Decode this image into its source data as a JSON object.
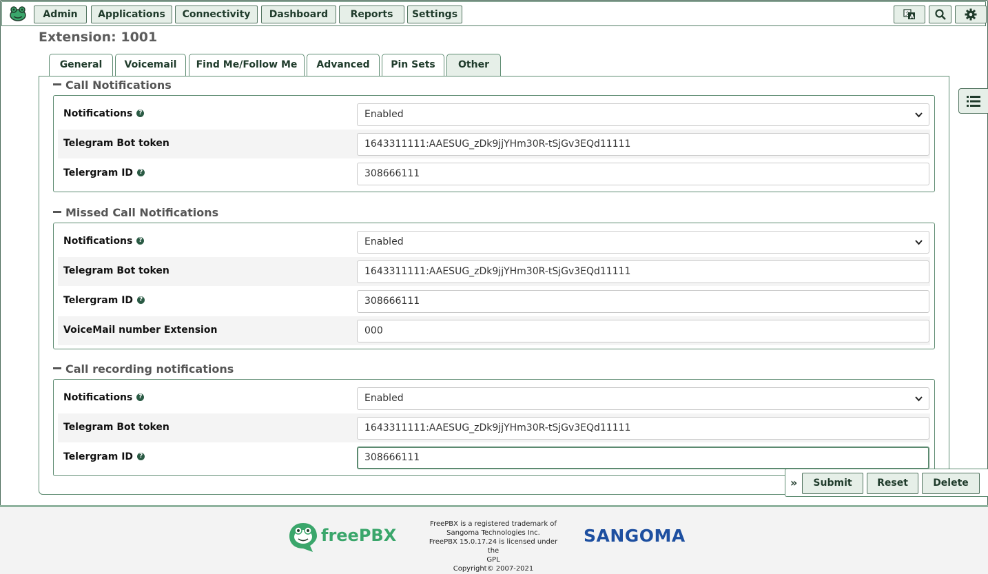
{
  "nav": {
    "items": [
      "Admin",
      "Applications",
      "Connectivity",
      "Dashboard",
      "Reports",
      "Settings"
    ],
    "icons": [
      "language-icon",
      "search-icon",
      "gear-icon"
    ]
  },
  "page": {
    "title": "Extension: 1001"
  },
  "tabs": [
    "General",
    "Voicemail",
    "Find Me/Follow Me",
    "Advanced",
    "Pin Sets",
    "Other"
  ],
  "active_tab": "Other",
  "sections": [
    {
      "title": "Call Notifications",
      "rows": [
        {
          "label": "Notifications",
          "value": "Enabled"
        },
        {
          "label": "Telegram Bot token",
          "value": "1643311111:AAESUG_zDk9jjYHm30R-tSjGv3EQd11111"
        },
        {
          "label": "Telergram ID",
          "value": "308666111"
        }
      ]
    },
    {
      "title": "Missed Call Notifications",
      "rows": [
        {
          "label": "Notifications",
          "value": "Enabled"
        },
        {
          "label": "Telegram Bot token",
          "value": "1643311111:AAESUG_zDk9jjYHm30R-tSjGv3EQd11111"
        },
        {
          "label": "Telergram ID",
          "value": "308666111"
        },
        {
          "label": "VoiceMail number Extension",
          "value": "000"
        }
      ]
    },
    {
      "title": "Call recording notifications",
      "rows": [
        {
          "label": "Notifications",
          "value": "Enabled"
        },
        {
          "label": "Telegram Bot token",
          "value": "1643311111:AAESUG_zDk9jjYHm30R-tSjGv3EQd11111"
        },
        {
          "label": "Telergram ID",
          "value": "308666111"
        }
      ]
    }
  ],
  "actions": {
    "expand": "»",
    "submit": "Submit",
    "reset": "Reset",
    "delete": "Delete"
  },
  "footer": {
    "freepbx_logo_text": "freePBX",
    "legal_lines": [
      "FreePBX is a registered trademark of",
      "Sangoma Technologies Inc.",
      "FreePBX 15.0.17.24 is licensed under the",
      "GPL",
      "Copyright© 2007-2021"
    ],
    "sangoma_logo_text": "SANGOMA"
  },
  "colors": {
    "accent": "#5c8a70",
    "button_bg": "#e6efe8",
    "text_dark": "#1f3b2b",
    "freepbx_green": "#3aa66b",
    "sangoma_blue": "#1d4fa0",
    "sangoma_orange": "#f37021"
  }
}
